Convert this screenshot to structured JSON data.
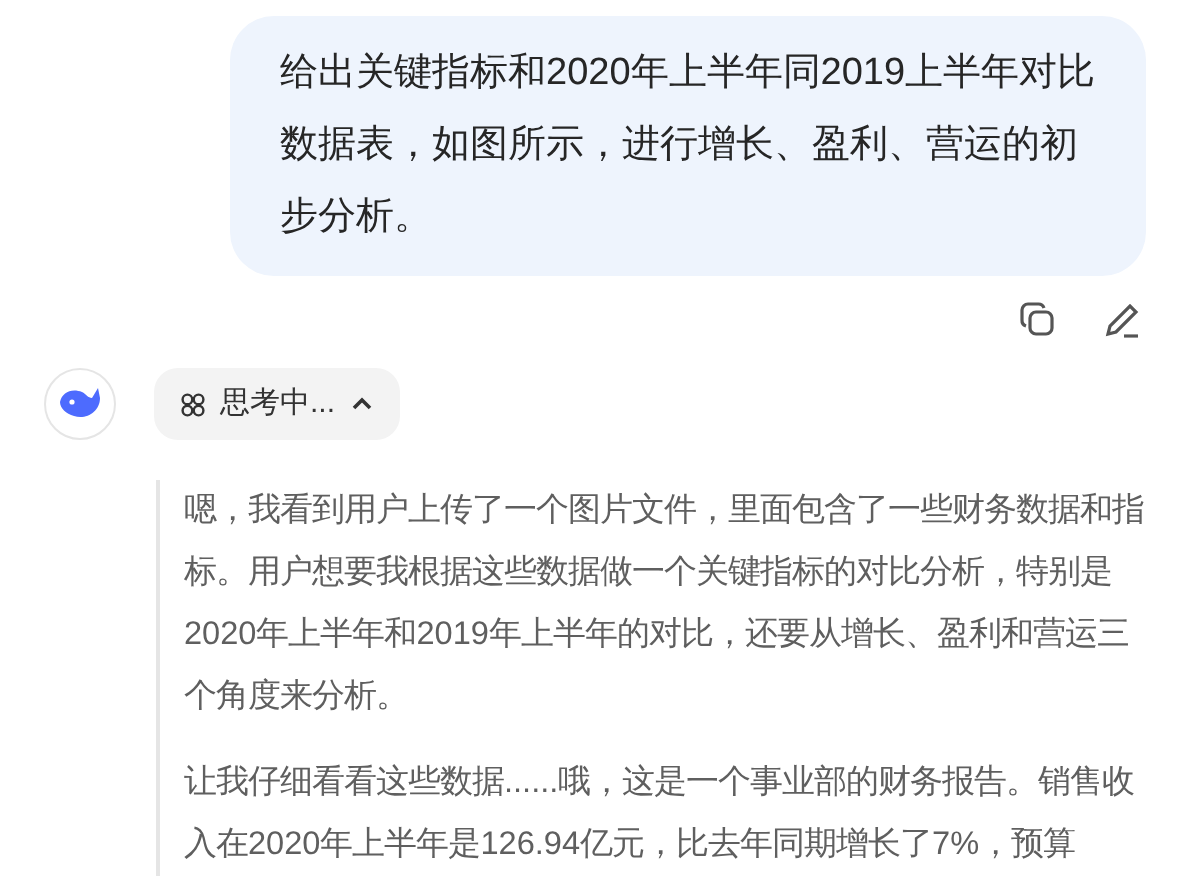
{
  "user_message": {
    "text": "给出关键指标和2020年上半年同2019上半年对比数据表，如图所示，进行增长、盈利、营运的初步分析。"
  },
  "thinking": {
    "label": "思考中...",
    "expanded": true,
    "paragraphs": [
      "嗯，我看到用户上传了一个图片文件，里面包含了一些财务数据和指标。用户想要我根据这些数据做一个关键指标的对比分析，特别是2020年上半年和2019年上半年的对比，还要从增长、盈利和营运三个角度来分析。",
      "让我仔细看看这些数据......哦，这是一个事业部的财务报告。销售收入在2020年上半年是126.94亿元，比去年同期增长了7%，预算"
    ]
  }
}
